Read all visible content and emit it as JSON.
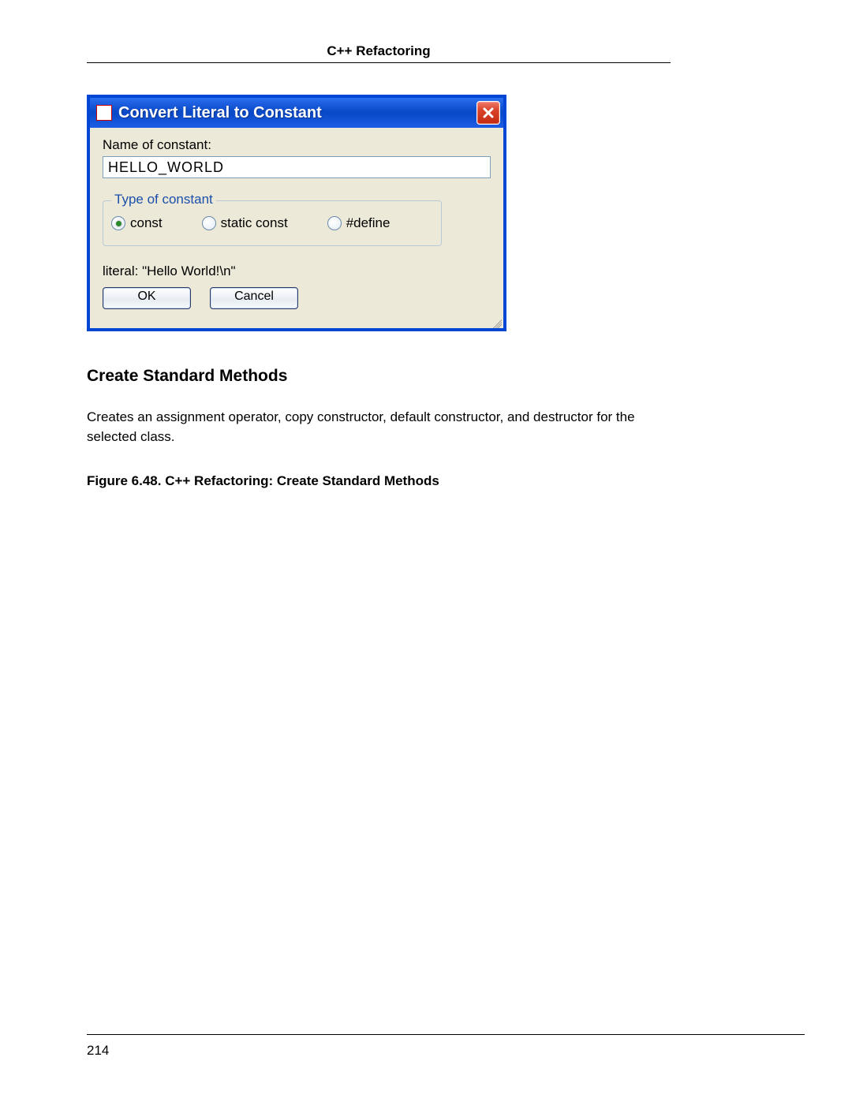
{
  "header": {
    "title": "C++ Refactoring"
  },
  "dialog": {
    "title": "Convert Literal to Constant",
    "name_label": "Name of constant:",
    "name_value": "HELLO_WORLD",
    "group_label": "Type of constant",
    "options": {
      "const": "const",
      "static_const": "static const",
      "define": "#define"
    },
    "selected": "const",
    "literal_line": "literal: \"Hello World!\\n\"",
    "ok": "OK",
    "cancel": "Cancel"
  },
  "section": {
    "heading": "Create Standard Methods",
    "body": "Creates an assignment operator, copy constructor, default constructor, and destructor for the selected class.",
    "figure_caption": "Figure 6.48. C++ Refactoring: Create Standard Methods"
  },
  "footer": {
    "page_number": "214"
  }
}
